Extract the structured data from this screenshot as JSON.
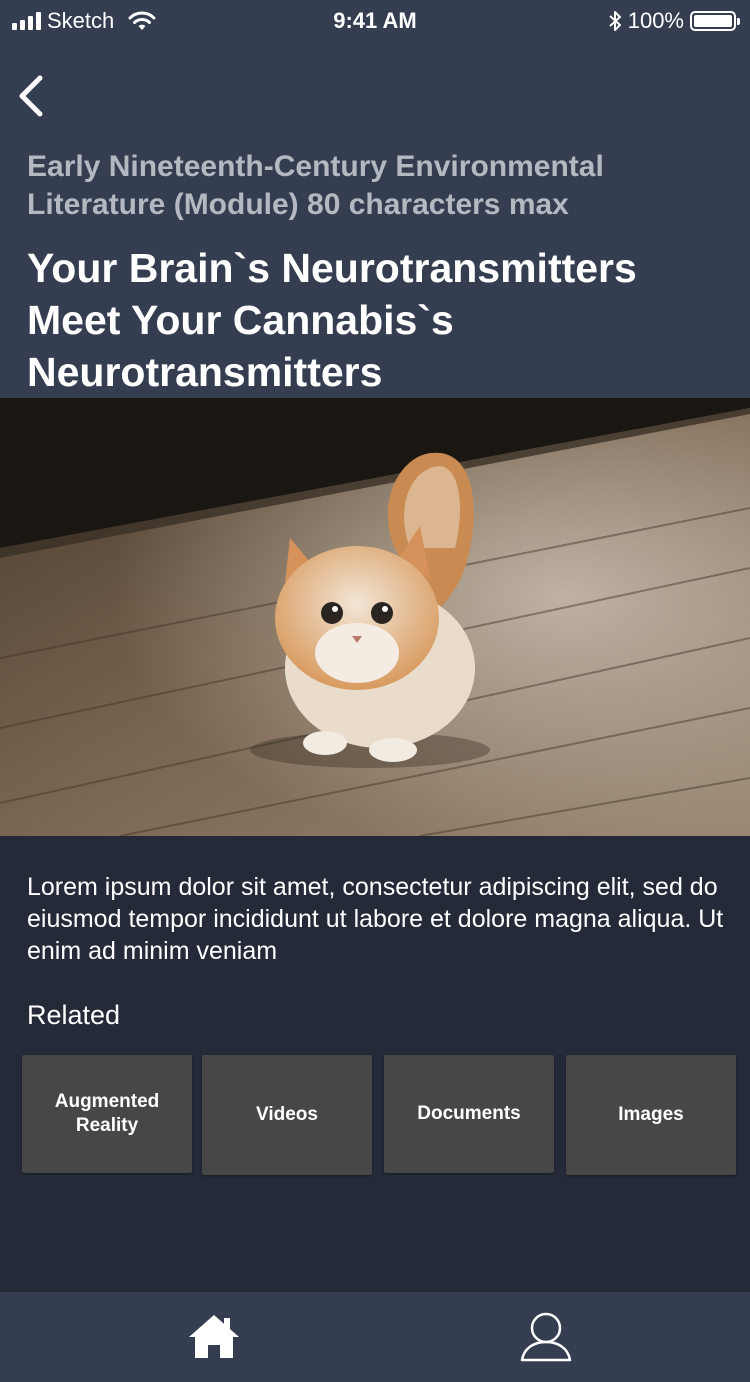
{
  "status_bar": {
    "carrier": "Sketch",
    "time": "9:41 AM",
    "battery": "100%"
  },
  "header": {
    "module": "Early Nineteenth-Century Environmental Literature (Module) 80 characters max",
    "title": "Your Brain`s Neurotransmitters Meet Your Cannabis`s Neurotransmitters"
  },
  "content": {
    "body": "Lorem ipsum dolor sit amet, consectetur adipiscing elit, sed do eiusmod tempor incididunt ut labore et dolore magna aliqua. Ut enim ad minim veniam",
    "related_label": "Related",
    "related": [
      {
        "label": "Augmented Reality"
      },
      {
        "label": "Videos"
      },
      {
        "label": "Documents"
      },
      {
        "label": "Images"
      }
    ]
  },
  "icons": {
    "back": "chevron-left-icon",
    "home": "home-icon",
    "profile": "user-icon"
  },
  "colors": {
    "header_bg": "#353e50",
    "page_bg": "#242a38",
    "tile_bg": "#474747",
    "module_text": "#b4b8c0"
  }
}
